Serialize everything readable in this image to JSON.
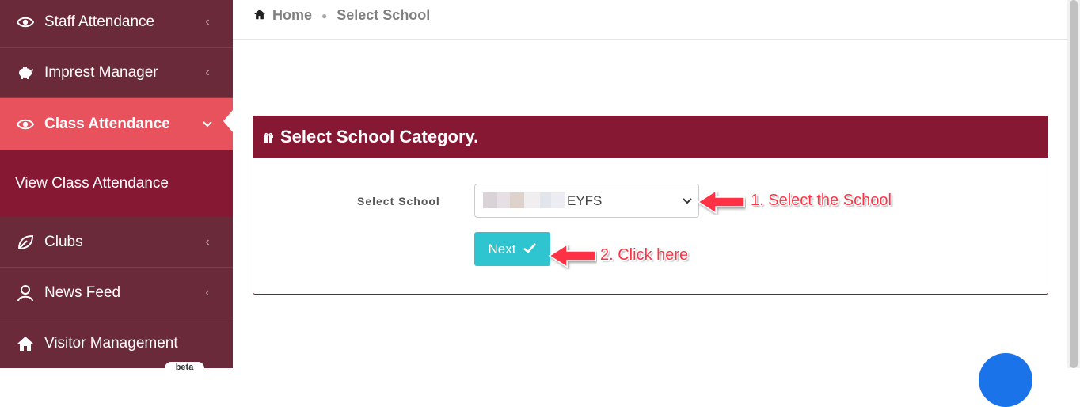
{
  "sidebar": {
    "items": [
      {
        "label": "Staff Attendance",
        "icon": "eye-icon"
      },
      {
        "label": "Imprest Manager",
        "icon": "piggy-bank-icon"
      },
      {
        "label": "Class Attendance",
        "icon": "eye-icon",
        "active": true
      },
      {
        "label": "Clubs",
        "icon": "leaf-icon"
      },
      {
        "label": "News Feed",
        "icon": "user-outline-icon"
      },
      {
        "label": "Visitor Management",
        "icon": "home-icon"
      }
    ],
    "sub_item": "View Class Attendance",
    "badge": "beta"
  },
  "breadcrumb": {
    "home": "Home",
    "current": "Select School"
  },
  "panel": {
    "title": "Select School Category.",
    "field_label": "Select School",
    "select_value": "EYFS",
    "button_label": "Next"
  },
  "annotations": {
    "step1": "1. Select the School",
    "step2": "2. Click here"
  },
  "colors": {
    "sidebar": "#6b2a3a",
    "active": "#e8525c",
    "brand": "#861834",
    "button": "#2ec5d0",
    "annotation": "#ff3344"
  }
}
